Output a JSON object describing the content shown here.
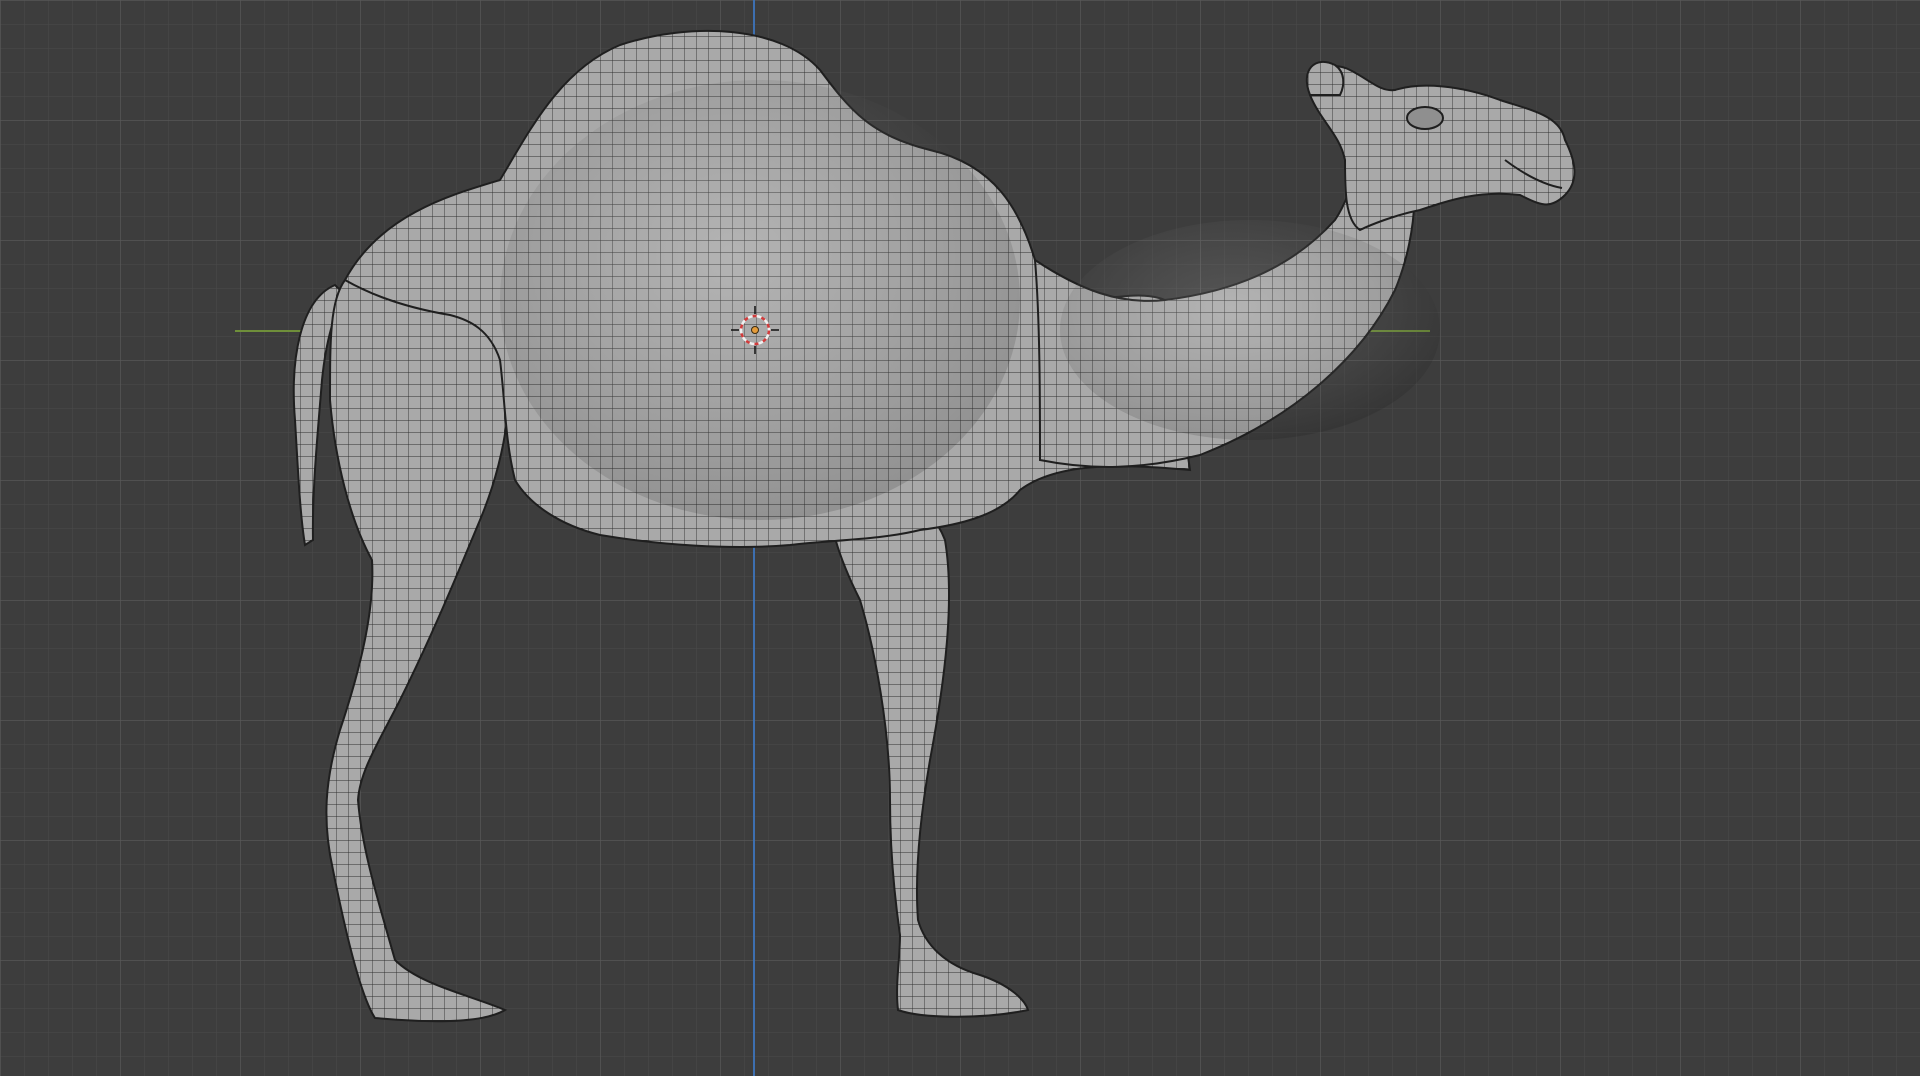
{
  "viewport": {
    "background_color": "#3d3d3d",
    "grid_minor_color": "#4a4a4a",
    "grid_major_color": "#575757",
    "x_axis_color": "#6f8f3a",
    "z_axis_color": "#3d6fb0"
  },
  "model": {
    "object_name": "camel",
    "display_mode": "wireframe-overlay",
    "surface_color": "#a9a9a9",
    "wire_color": "#2a2a2a"
  },
  "cursor": {
    "icon": "3d-cursor-icon",
    "ring_color_a": "#d23b3b",
    "ring_color_b": "#f0f0f0"
  }
}
